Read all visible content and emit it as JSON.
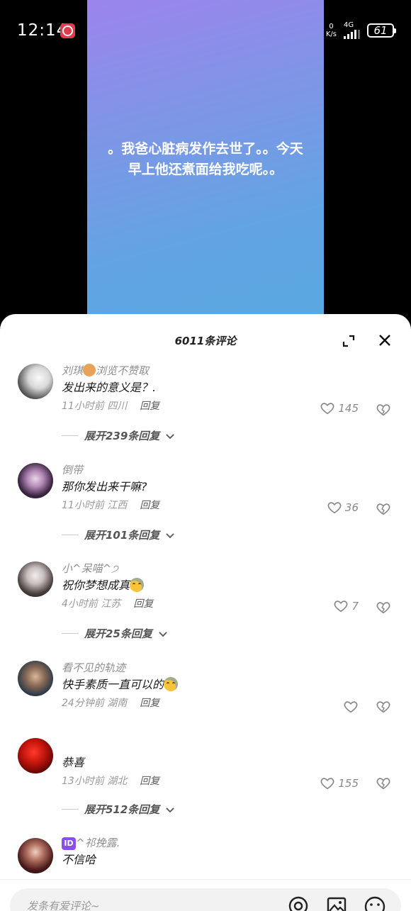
{
  "status_bar": {
    "time": "12:14",
    "net_speed_top": "0",
    "net_speed_bottom": "K/s",
    "network": "4G",
    "battery": "61"
  },
  "video": {
    "caption": "。我爸心脏病发作去世了。。今天早上他还煮面给我吃呢。。"
  },
  "comments_sheet": {
    "title": "6011条评论",
    "comments": [
      {
        "user": "刘琪",
        "user_suffix": "浏览不赞取",
        "text": "发出来的意义是？.",
        "time": "11小时前",
        "location": "四川",
        "reply_label": "回复",
        "likes": "145",
        "expand_label": "展开239条回复"
      },
      {
        "user": "倒带",
        "text": "那你发出来干嘛?",
        "time": "11小时前",
        "location": "江西",
        "reply_label": "回复",
        "likes": "36",
        "expand_label": "展开101条回复"
      },
      {
        "user": "小^呆喵^੭",
        "text": "祝你梦想成真",
        "time": "4小时前",
        "location": "江苏",
        "reply_label": "回复",
        "likes": "7",
        "expand_label": "展开25条回复"
      },
      {
        "user": "看不见的轨迹",
        "text": "快手素质一直可以的",
        "time": "24分钟前",
        "location": "湖南",
        "reply_label": "回复",
        "likes": ""
      },
      {
        "user": "",
        "text": "恭喜",
        "time": "13小时前",
        "location": "湖北",
        "reply_label": "回复",
        "likes": "155",
        "expand_label": "展开512条回复"
      },
      {
        "user_badge": "ID",
        "user": "^祁挽露.",
        "text": "不信哈"
      }
    ]
  },
  "input_bar": {
    "placeholder": "发条有爱评论~"
  },
  "colors": {
    "accent_gradient_top": "#9c84ee",
    "accent_gradient_bottom": "#58a8e2"
  }
}
